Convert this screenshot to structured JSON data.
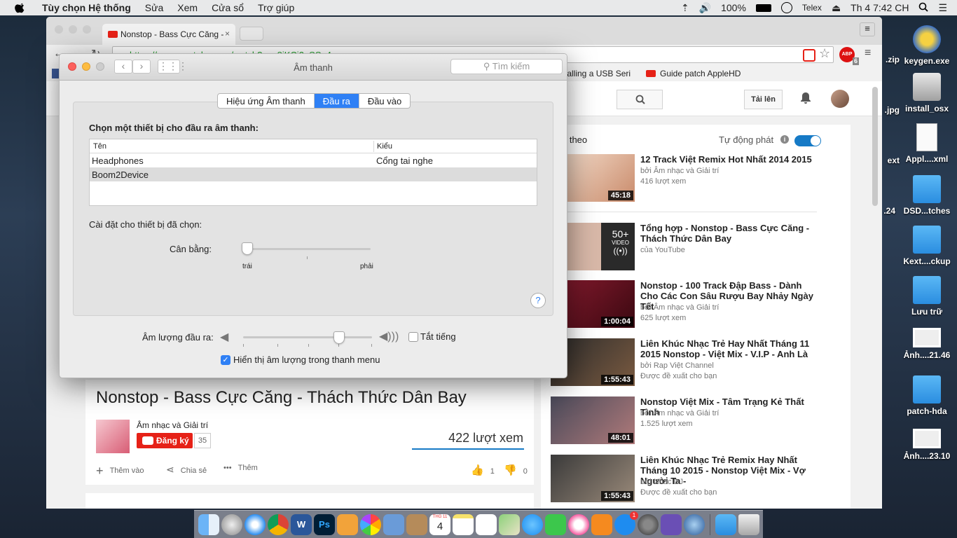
{
  "menubar": {
    "app_name": "Tùy chọn Hệ thống",
    "items": [
      "Sửa",
      "Xem",
      "Cửa sổ",
      "Trợ giúp"
    ],
    "battery": "100%",
    "input_method": "Telex",
    "clock": "Th 4  7:42 CH"
  },
  "desktop": {
    "icons": [
      "keygen.exe",
      "install_osx",
      "Appl....xml",
      "DSD...tches",
      "Kext....ckup",
      "Lưu trữ",
      "Ảnh....21.46",
      "patch-hda",
      "Ảnh....23.10"
    ],
    "partial_labels": [
      ".zip",
      ".jpg",
      "ext",
      ".24"
    ]
  },
  "browser": {
    "tab_title": "Nonstop - Bass Cực Căng -",
    "url": "https://www.youtube.com/watch?v=_8iKCj2uSSo4",
    "bookmarks": [
      "talling a USB Seri",
      "Guide patch AppleHD"
    ],
    "adblock_badge": "6",
    "adblock_label": "ABP"
  },
  "youtube": {
    "upload_label": "Tải lên",
    "up_next": "p theo",
    "autoplay": "Tự động phát",
    "videos": [
      {
        "title": "12 Track Việt Remix Hot Nhất 2014 2015",
        "channel": "bởi Âm nhạc và Giải trí",
        "meta": "416 lượt xem",
        "duration": "45:18"
      },
      {
        "title": "Tổng hợp - Nonstop - Bass Cực Căng - Thách Thức Dân Bay",
        "channel": "của YouTube",
        "meta": "",
        "duration": "50+",
        "duration_sub": "VIDEO"
      },
      {
        "title": "Nonstop - 100 Track Đập Bass - Dành Cho Các Con Sâu Rượu Bay Nhảy Ngày Tết",
        "channel": "bởi Âm nhạc và Giải trí",
        "meta": "625 lượt xem",
        "duration": "1:00:04"
      },
      {
        "title": "Liên Khúc Nhạc Trẻ Hay Nhất Tháng 11 2015 Nonstop - Việt Mix - V.I.P - Anh Là",
        "channel": "bởi Rap Việt Channel",
        "meta": "Được đề xuất cho bạn",
        "duration": "1:55:43"
      },
      {
        "title": "Nonstop Việt Mix - Tâm Trạng Kẻ Thất Tình",
        "channel": "bởi Âm nhạc và Giải trí",
        "meta": "1.525 lượt xem",
        "duration": "48:01"
      },
      {
        "title": "Liên Khúc Nhạc Trẻ Remix Hay Nhất Tháng 10 2015 - Nonstop Việt Mix - Vợ Người Ta -",
        "channel": "bởi Nhac DJ",
        "meta": "Được đề xuất cho bạn",
        "duration": "1:55:43"
      }
    ],
    "main": {
      "title": "Nonstop - Bass Cực Căng - Thách Thức Dân Bay",
      "channel": "Âm nhạc và Giải trí",
      "subscribe": "Đăng ký",
      "sub_count": "35",
      "views": "422 lượt xem",
      "add_to": "Thêm vào",
      "share": "Chia sẻ",
      "more": "Thêm",
      "likes": "1",
      "dislikes": "0"
    }
  },
  "sound": {
    "window_title": "Âm thanh",
    "search_placeholder": "Tìm kiếm",
    "tabs": [
      "Hiệu ứng Âm thanh",
      "Đầu ra",
      "Đầu vào"
    ],
    "selected_tab": "Đầu ra",
    "choose_label": "Chọn một thiết bị cho đầu ra âm thanh:",
    "col_name": "Tên",
    "col_type": "Kiểu",
    "devices": [
      {
        "name": "Headphones",
        "type": "Cổng tai nghe"
      },
      {
        "name": "Boom2Device",
        "type": ""
      }
    ],
    "selected_device": "Boom2Device",
    "settings_label": "Cài đặt cho thiết bị đã chọn:",
    "balance_label": "Cân bằng:",
    "balance_left": "trái",
    "balance_right": "phải",
    "balance_value": 0.0,
    "help": "?",
    "volume_label": "Âm lượng đầu ra:",
    "volume_value": 0.77,
    "mute_label": "Tắt tiếng",
    "mute_checked": false,
    "show_in_menu_label": "Hiển thị âm lượng trong thanh menu",
    "show_in_menu_checked": true
  },
  "colors": {
    "accent": "#2f80f5",
    "youtube_red": "#e62117",
    "link_blue": "#167ac6"
  },
  "dock": {
    "calendar_month": "THG 11",
    "calendar_day": "4",
    "appstore_badge": "1"
  }
}
